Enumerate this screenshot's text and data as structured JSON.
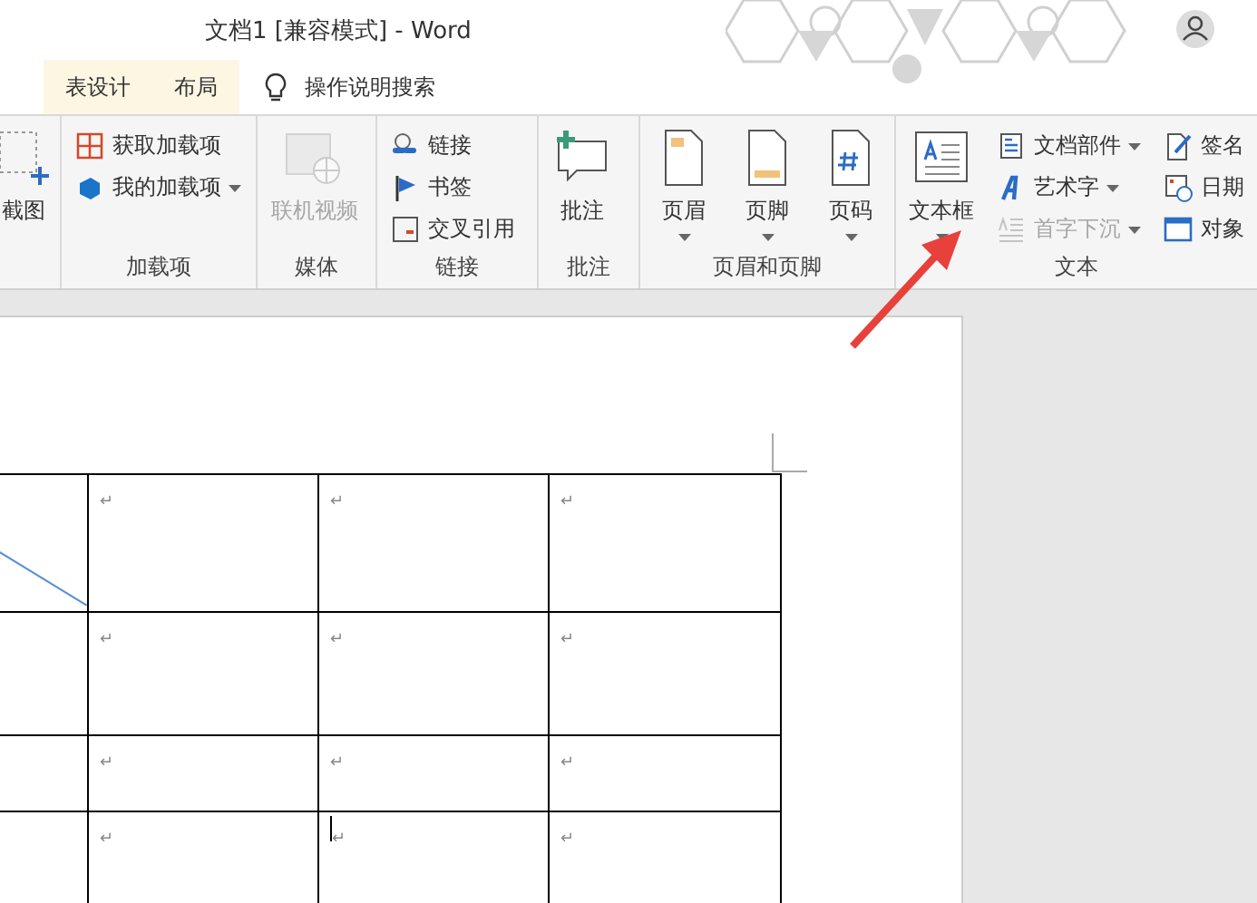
{
  "window": {
    "title": "文档1 [兼容模式]  -  Word"
  },
  "tabs": [
    {
      "label": "表设计",
      "selected": false
    },
    {
      "label": "布局",
      "selected": false
    }
  ],
  "search": {
    "placeholder": "操作说明搜索"
  },
  "ribbon": {
    "groups": [
      {
        "items": [
          {
            "kind": "large",
            "label": "截图",
            "disabled": false,
            "dropdown": false
          }
        ]
      },
      {
        "label": "加载项",
        "items": [
          {
            "kind": "small",
            "label": "获取加载项",
            "disabled": false,
            "dropdown": false
          },
          {
            "kind": "small",
            "label": "我的加载项",
            "disabled": false,
            "dropdown": true
          }
        ]
      },
      {
        "label": "媒体",
        "items": [
          {
            "kind": "large",
            "label": "联机视频",
            "disabled": true,
            "dropdown": false
          }
        ]
      },
      {
        "label": "链接",
        "items": [
          {
            "kind": "small",
            "label": "链接",
            "disabled": false,
            "dropdown": false
          },
          {
            "kind": "small",
            "label": "书签",
            "disabled": false,
            "dropdown": false
          },
          {
            "kind": "small",
            "label": "交叉引用",
            "disabled": false,
            "dropdown": false
          }
        ]
      },
      {
        "label": "批注",
        "items": [
          {
            "kind": "large",
            "label": "批注",
            "disabled": false,
            "dropdown": false
          }
        ]
      },
      {
        "label": "页眉和页脚",
        "items": [
          {
            "kind": "large",
            "label": "页眉",
            "disabled": false,
            "dropdown": true
          },
          {
            "kind": "large",
            "label": "页脚",
            "disabled": false,
            "dropdown": true
          },
          {
            "kind": "large",
            "label": "页码",
            "disabled": false,
            "dropdown": true
          }
        ]
      },
      {
        "label": "文本",
        "items": [
          {
            "kind": "large",
            "label": "文本框",
            "disabled": false,
            "dropdown": true
          },
          {
            "kind": "small",
            "label": "文档部件",
            "disabled": false,
            "dropdown": true
          },
          {
            "kind": "small",
            "label": "艺术字",
            "disabled": false,
            "dropdown": true
          },
          {
            "kind": "small",
            "label": "首字下沉",
            "disabled": true,
            "dropdown": true
          },
          {
            "kind": "small",
            "label": "签名",
            "disabled": false,
            "dropdown": false
          },
          {
            "kind": "small",
            "label": "日期",
            "disabled": false,
            "dropdown": false
          },
          {
            "kind": "small",
            "label": "对象",
            "disabled": false,
            "dropdown": false
          }
        ]
      }
    ]
  },
  "table": {
    "rows": [
      {
        "cells": [
          {
            "text": "",
            "diagonal": true,
            "cursor": false
          },
          {
            "text": "↵",
            "diagonal": false,
            "cursor": false
          },
          {
            "text": "↵",
            "diagonal": false,
            "cursor": false
          },
          {
            "text": "↵",
            "diagonal": false,
            "cursor": false
          }
        ]
      },
      {
        "cells": [
          {
            "text": "",
            "diagonal": false,
            "cursor": false
          },
          {
            "text": "↵",
            "diagonal": false,
            "cursor": false
          },
          {
            "text": "↵",
            "diagonal": false,
            "cursor": false
          },
          {
            "text": "↵",
            "diagonal": false,
            "cursor": false
          }
        ]
      },
      {
        "cells": [
          {
            "text": "",
            "diagonal": false,
            "cursor": false
          },
          {
            "text": "↵",
            "diagonal": false,
            "cursor": false
          },
          {
            "text": "↵",
            "diagonal": false,
            "cursor": false
          },
          {
            "text": "↵",
            "diagonal": false,
            "cursor": false
          }
        ]
      },
      {
        "cells": [
          {
            "text": "",
            "diagonal": false,
            "cursor": false
          },
          {
            "text": "↵",
            "diagonal": false,
            "cursor": false
          },
          {
            "text": "↵",
            "diagonal": false,
            "cursor": true
          },
          {
            "text": "↵",
            "diagonal": false,
            "cursor": false
          }
        ]
      }
    ]
  }
}
